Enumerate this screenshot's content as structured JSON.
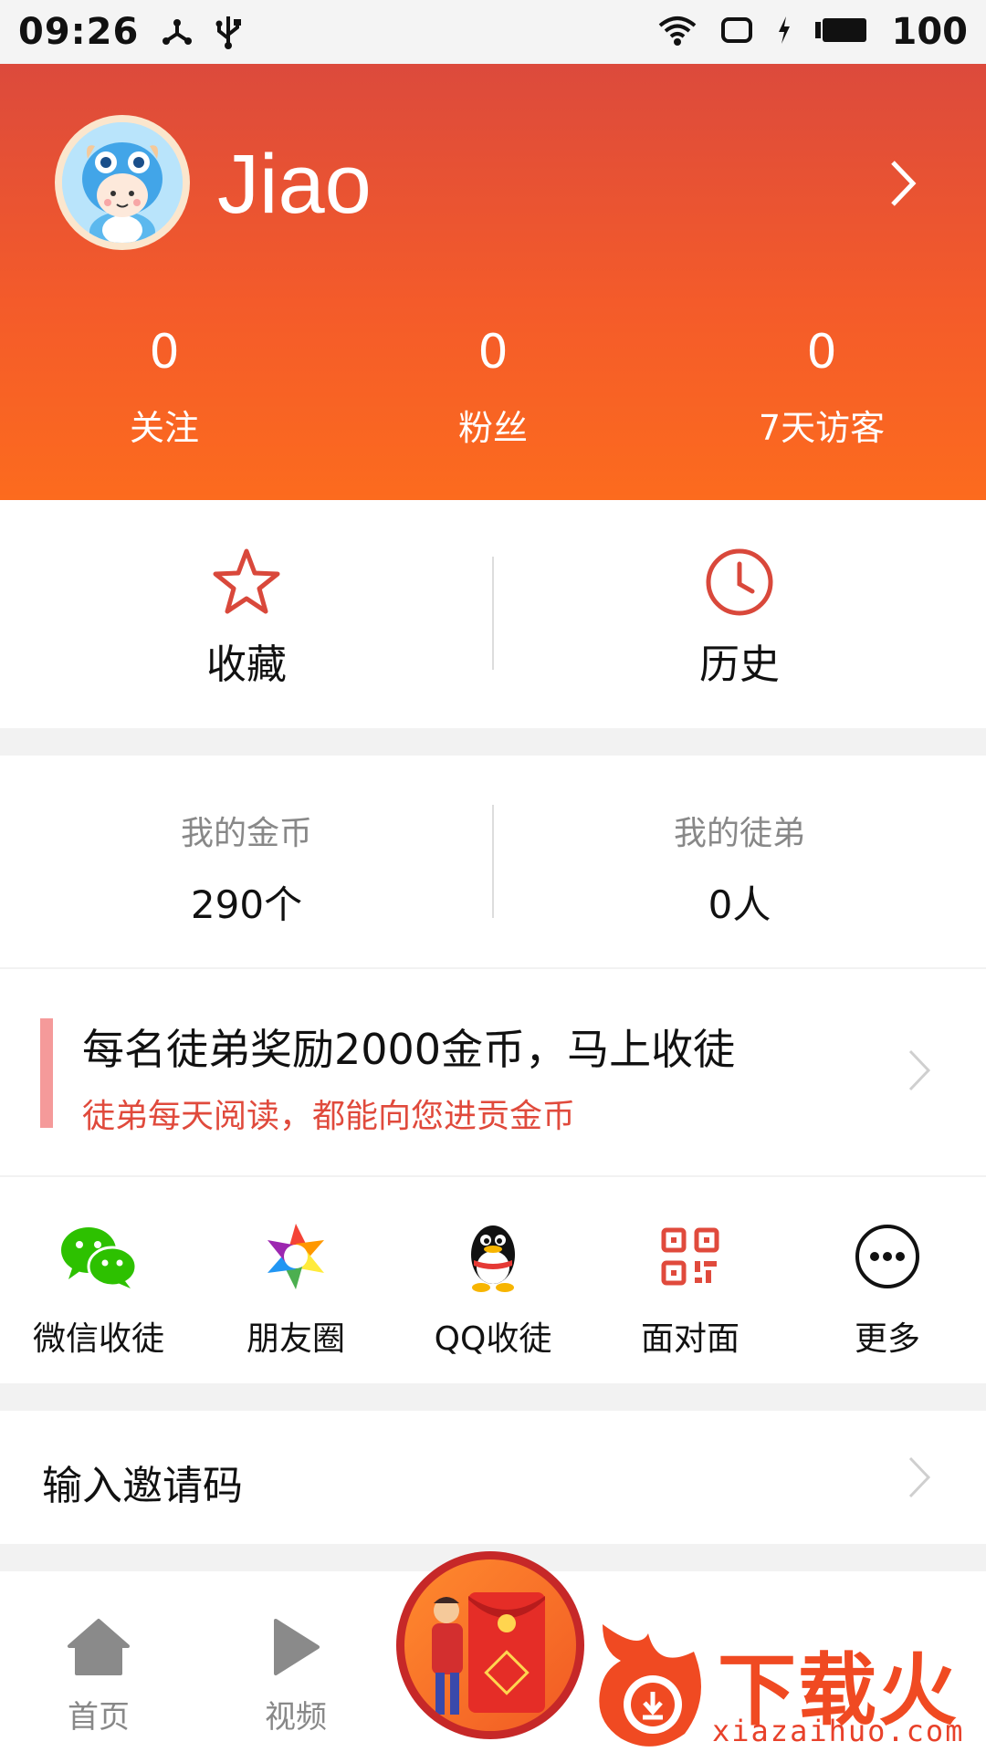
{
  "status_bar": {
    "time": "09:26",
    "battery": "100"
  },
  "profile": {
    "username": "Jiao"
  },
  "stats": [
    {
      "value": "0",
      "label": "关注"
    },
    {
      "value": "0",
      "label": "粉丝"
    },
    {
      "value": "0",
      "label": "7天访客"
    }
  ],
  "shortcuts": {
    "favorites": "收藏",
    "history": "历史"
  },
  "account": {
    "coins_title": "我的金币",
    "coins_value": "290个",
    "apprentice_title": "我的徒弟",
    "apprentice_value": "0人"
  },
  "promo": {
    "title": "每名徒弟奖励2000金币，马上收徒",
    "subtitle": "徒弟每天阅读，都能向您进贡金币"
  },
  "share_options": [
    {
      "label": "微信收徒",
      "icon": "wechat-icon"
    },
    {
      "label": "朋友圈",
      "icon": "moments-icon"
    },
    {
      "label": "QQ收徒",
      "icon": "qq-icon"
    },
    {
      "label": "面对面",
      "icon": "qrcode-icon"
    },
    {
      "label": "更多",
      "icon": "more-icon"
    }
  ],
  "invite": {
    "label": "输入邀请码"
  },
  "bottom_nav": [
    {
      "label": "首页",
      "icon": "home-icon"
    },
    {
      "label": "视频",
      "icon": "play-icon"
    }
  ],
  "watermark": {
    "brand": "下载火",
    "url": "xiazaihuo.com"
  },
  "colors": {
    "header_top": "#dc4a3c",
    "header_bottom": "#fc6b1e",
    "accent_red": "#e04a3c",
    "wechat_green": "#2dc100",
    "muted": "#888888"
  }
}
